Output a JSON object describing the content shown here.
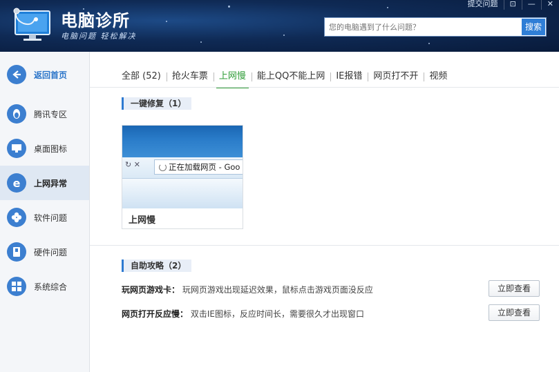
{
  "header": {
    "title": "电脑诊所",
    "slogan": "电脑问题 轻松解决",
    "top_links": [
      "提交问题",
      "⊡",
      "—",
      "✕"
    ],
    "search_placeholder": "您的电脑遇到了什么问题？",
    "search_button": "搜索"
  },
  "sidebar": {
    "items": [
      {
        "label": "返回首页",
        "icon": "back-arrow-icon",
        "active": false
      },
      {
        "label": "腾讯专区",
        "icon": "qq-penguin-icon",
        "active": false
      },
      {
        "label": "桌面图标",
        "icon": "monitor-icon",
        "active": false
      },
      {
        "label": "上网异常",
        "icon": "ie-browser-icon",
        "active": true
      },
      {
        "label": "软件问题",
        "icon": "clover-icon",
        "active": false
      },
      {
        "label": "硬件问题",
        "icon": "hardware-icon",
        "active": false
      },
      {
        "label": "系统综合",
        "icon": "windows-icon",
        "active": false
      }
    ]
  },
  "tabs": [
    {
      "label": "全部 (52)",
      "active": false
    },
    {
      "label": "抢火车票",
      "active": false
    },
    {
      "label": "上网慢",
      "active": true
    },
    {
      "label": "能上QQ不能上网",
      "active": false
    },
    {
      "label": "IE报错",
      "active": false
    },
    {
      "label": "网页打不开",
      "active": false
    },
    {
      "label": "视频",
      "active": false
    }
  ],
  "quick_fix": {
    "title": "一键修复（1）",
    "cards": [
      {
        "label": "上网慢",
        "thumb_text": "正在加载网页 - Goo"
      }
    ]
  },
  "self_help": {
    "title": "自助攻略（2）",
    "items": [
      {
        "title": "玩网页游戏卡：",
        "desc": "玩网页游戏出现延迟效果，鼠标点击游戏页面没反应",
        "button": "立即查看"
      },
      {
        "title": "网页打开反应慢：",
        "desc": "双击IE图标，反应时间长，需要很久才出现窗口",
        "button": "立即查看"
      }
    ]
  },
  "colors": {
    "accent_blue": "#2e7ad1",
    "active_green": "#2e9c36",
    "header_dark": "#0f2a55"
  }
}
